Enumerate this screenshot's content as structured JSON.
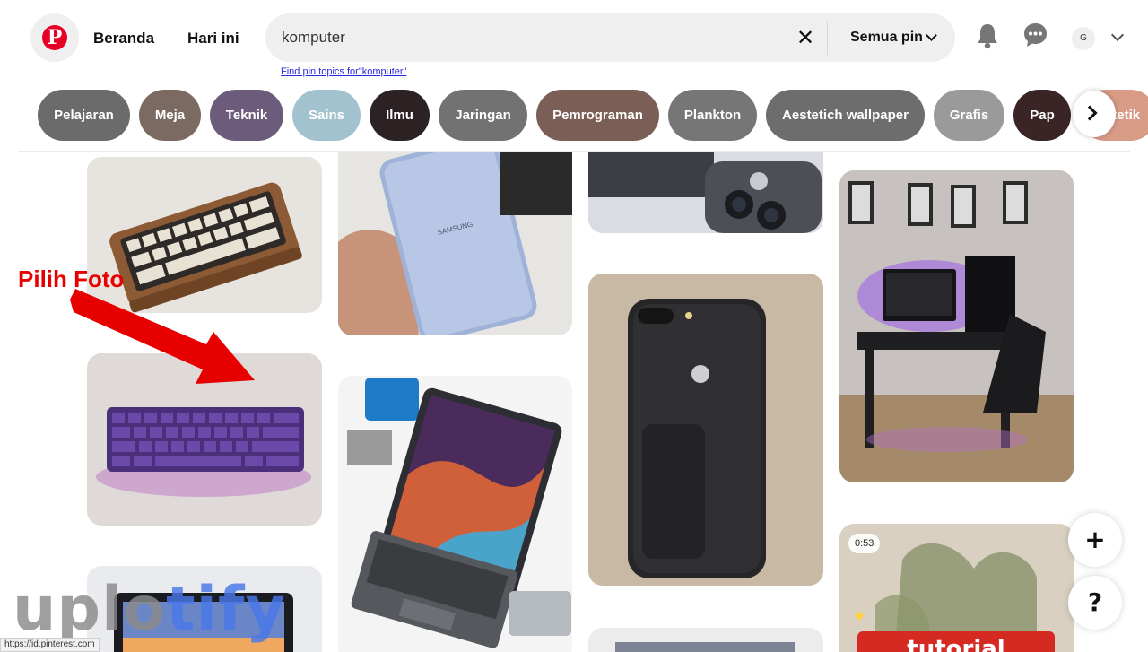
{
  "header": {
    "logo_icon": "pinterest-logo-icon",
    "nav": {
      "home": "Beranda",
      "today": "Hari ini"
    },
    "search": {
      "value": "komputer",
      "clear_icon": "close-icon",
      "filter_label": "Semua pin",
      "hint": "Find pin topics for\"komputer\""
    },
    "icons": [
      "bell-icon",
      "chat-icon"
    ],
    "avatar_initial": "G"
  },
  "chips": [
    {
      "label": "Pelajaran",
      "color": "#6b6b6b"
    },
    {
      "label": "Meja",
      "color": "#7a6a62"
    },
    {
      "label": "Teknik",
      "color": "#6c5b7b"
    },
    {
      "label": "Sains",
      "color": "#a3c2cf"
    },
    {
      "label": "Ilmu",
      "color": "#2c2224"
    },
    {
      "label": "Jaringan",
      "color": "#727272"
    },
    {
      "label": "Pemrograman",
      "color": "#7b5e55"
    },
    {
      "label": "Plankton",
      "color": "#767676"
    },
    {
      "label": "Aestetich wallpaper",
      "color": "#6d6d6d"
    },
    {
      "label": "Grafis",
      "color": "#9a9a9a"
    },
    {
      "label": "Pap",
      "color": "#3a2426"
    },
    {
      "label": "Estetik",
      "color": "#d79b86"
    }
  ],
  "pins": {
    "video_duration": "0:53",
    "video_title": "tutorial"
  },
  "annotation": {
    "label": "Pilih Foto",
    "color": "#e60000"
  },
  "floating": {
    "add": "+",
    "help": "?"
  },
  "watermark": {
    "part1": "uplo",
    "part2": "tify"
  },
  "status_url": "https://id.pinterest.com"
}
